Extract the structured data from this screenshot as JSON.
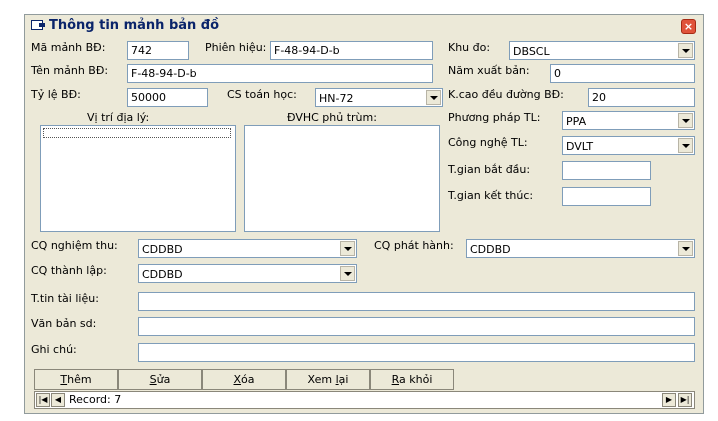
{
  "window": {
    "title": "Thông tin mảnh bản đồ",
    "close_glyph": "×"
  },
  "form": {
    "ma_manh_label": "Mã mảnh BĐ:",
    "ma_manh_value": "742",
    "phien_hieu_label": "Phiên hiệu:",
    "phien_hieu_value": "F-48-94-D-b",
    "khu_do_label": "Khu đo:",
    "khu_do_value": "DBSCL",
    "ten_manh_label": "Tên mảnh BĐ:",
    "ten_manh_value": "F-48-94-D-b",
    "nam_xb_label": "Năm xuất bản:",
    "nam_xb_value": "0",
    "ty_le_label": "Tỷ lệ BĐ:",
    "ty_le_value": "50000",
    "cs_toan_hoc_label": "CS toán học:",
    "cs_toan_hoc_value": "HN-72",
    "kcao_label": "K.cao đều đường BĐ:",
    "kcao_value": "20",
    "vi_tri_label": "Vị trí địa lý:",
    "dvhc_label": "ĐVHC phủ trùm:",
    "phuong_phap_label": "Phương pháp TL:",
    "phuong_phap_value": "PPA",
    "cong_nghe_label": "Công nghệ TL:",
    "cong_nghe_value": "DVLT",
    "tg_bat_dau_label": "T.gian bắt đầu:",
    "tg_bat_dau_value": "",
    "tg_ket_thuc_label": "T.gian kết thúc:",
    "tg_ket_thuc_value": "",
    "cq_nghiem_thu_label": "CQ nghiệm thu:",
    "cq_nghiem_thu_value": "CDDBD",
    "cq_phat_hanh_label": "CQ phát hành:",
    "cq_phat_hanh_value": "CDDBD",
    "cq_thanh_lap_label": "CQ thành lập:",
    "cq_thanh_lap_value": "CDDBD",
    "ttin_tai_lieu_label": "T.tin tài liệu:",
    "ttin_tai_lieu_value": "",
    "van_ban_label": "Văn bản sd:",
    "van_ban_value": "",
    "ghi_chu_label": "Ghi chú:",
    "ghi_chu_value": ""
  },
  "buttons": {
    "them": {
      "hot": "T",
      "rest": "hêm"
    },
    "sua": {
      "hot": "S",
      "rest": "ửa"
    },
    "xoa": {
      "hot": "X",
      "rest": "óa"
    },
    "xem_lai": {
      "pre": "Xem ",
      "hot": "l",
      "rest": "ại"
    },
    "ra_khoi": {
      "hot": "R",
      "rest": "a khỏi"
    }
  },
  "nav": {
    "record_text": "Record: 7",
    "first_glyph": "|◀",
    "prev_glyph": "◀",
    "next_glyph": "▶",
    "last_glyph": "▶|"
  }
}
